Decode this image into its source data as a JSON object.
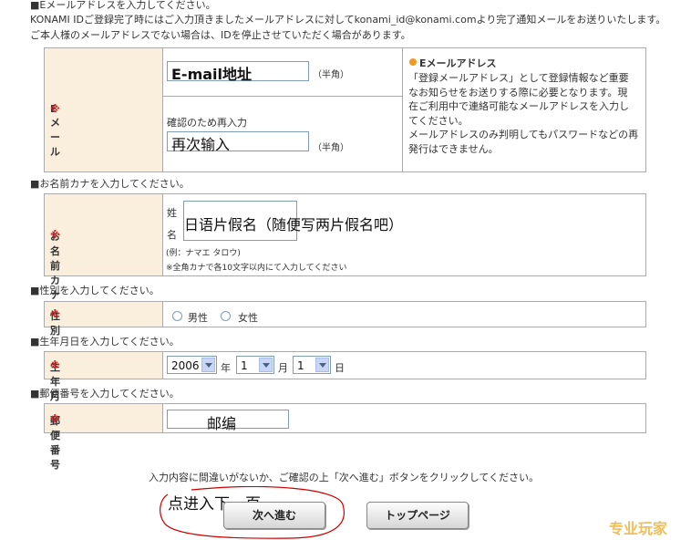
{
  "email_section": {
    "heading": "■Eメールアドレスを入力してください。",
    "notice_line1": "KONAMI IDご登録完了時にはご入力頂きましたメールアドレスに対してkonami_id@konami.comより完了通知メールをお送りいたします。",
    "notice_line2": "ご本人様のメールアドレスでない場合は、IDを停止させていただく場合があります。",
    "label": "Eメール",
    "required_mark": "※",
    "email_value": "E-mail地址",
    "email_suffix": "（半角）",
    "confirm_label": "確認のため再入力",
    "confirm_value": "再次输入",
    "confirm_suffix": "（半角）",
    "info_title": "Eメールアドレス",
    "info_lines": [
      "「登録メールアドレス」として登録情報など重要",
      "なお知らせをお送りする際に必要となります。現",
      "在ご利用中で連絡可能なメールアドレスを入力し",
      "てください。",
      "メールアドレスのみ判明してもパスワードなどの再",
      "発行はできません。"
    ]
  },
  "kana_section": {
    "heading": "■お名前カナを入力してください。",
    "label": "お名前カナ",
    "required_mark": "※",
    "sei": "姓",
    "mei": "名",
    "value": "日语片假名（随便写两片假名吧）",
    "example": "(例：ナマエ タロウ)",
    "note": "※全角カナで各10文字以内にて入力してください"
  },
  "gender_section": {
    "heading": "■性別を入力してください。",
    "label": "性別",
    "required_mark": "※",
    "male": "男性",
    "female": "女性"
  },
  "birth_section": {
    "heading": "■生年月日を入力してください。",
    "label": "生年月日",
    "required_mark": "※",
    "year": "2006",
    "year_unit": "年",
    "month": "1",
    "month_unit": "月",
    "day": "1",
    "day_unit": "日"
  },
  "postal_section": {
    "heading": "■郵便番号を入力してください。",
    "label": "郵便番号",
    "required_mark": "※",
    "value": "邮编"
  },
  "footer": {
    "instruction": "入力内容に間違いがないか、ご確認の上「次へ進む」ボタンをクリックしてください。",
    "annotation": "点进入下一页",
    "next_button": "次へ進む",
    "top_button": "トップページ",
    "watermark": "专业玩家"
  },
  "colors": {
    "label_bg": "#faeedd",
    "required": "#dd2222",
    "annotation_circle": "#cc0000",
    "info_bullet": "#f39a1e"
  }
}
